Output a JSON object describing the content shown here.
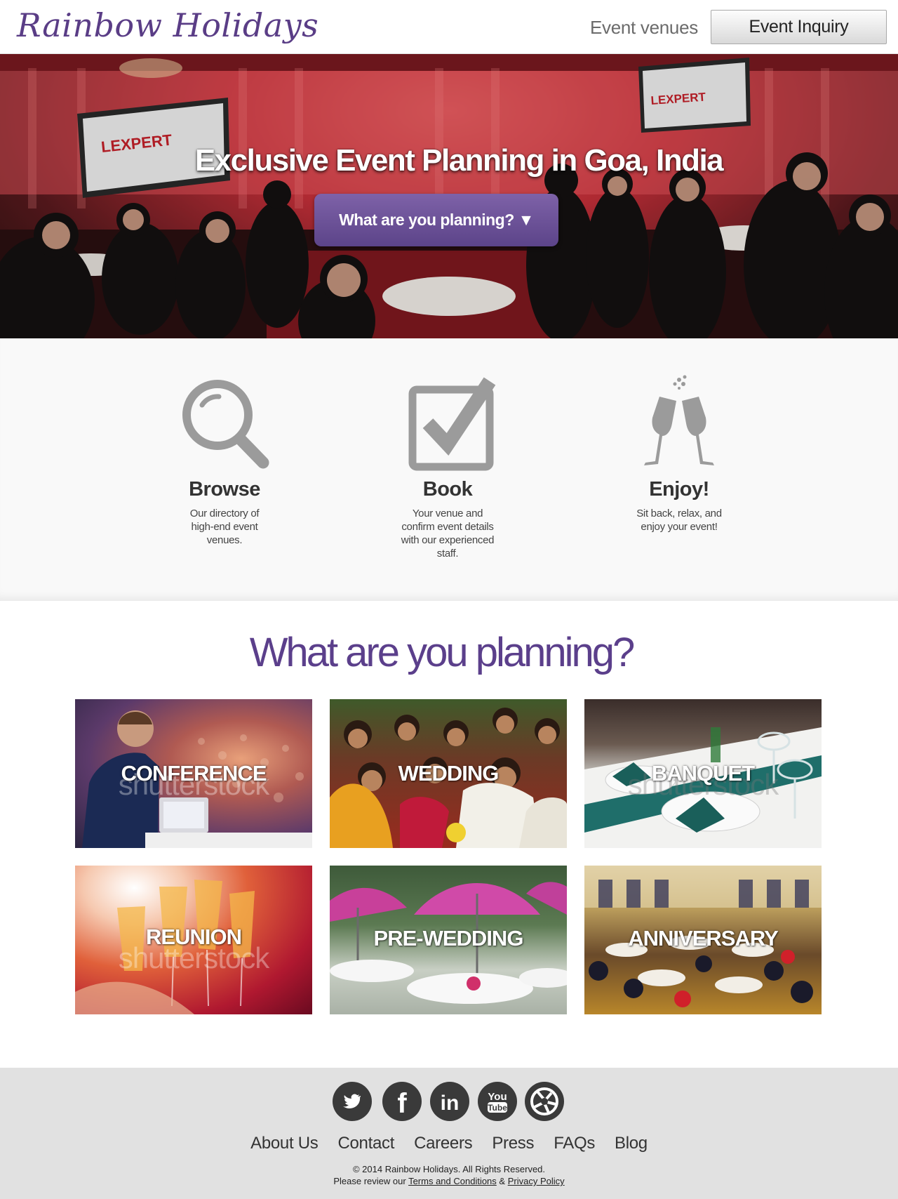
{
  "header": {
    "logo": "Rainbow Holidays",
    "nav_venues": "Event venues",
    "inquiry_button": "Event Inquiry"
  },
  "hero": {
    "title": "Exclusive Event Planning in Goa, India",
    "button_label": "What are you planning? ▼",
    "screen_text": "LEXPERT"
  },
  "steps": [
    {
      "icon": "magnifier-icon",
      "title": "Browse",
      "description": "Our directory of high-end event venues."
    },
    {
      "icon": "checkbox-icon",
      "title": "Book",
      "description": "Your venue and confirm event details with our experienced staff."
    },
    {
      "icon": "champagne-icon",
      "title": "Enjoy!",
      "description": "Sit back, relax, and enjoy your event!"
    }
  ],
  "planning": {
    "title": "What are you planning?",
    "watermark": "shutterstock",
    "tiles": [
      {
        "label": "CONFERENCE"
      },
      {
        "label": "WEDDING"
      },
      {
        "label": "BANQUET"
      },
      {
        "label": "REUNION"
      },
      {
        "label": "PRE-WEDDING"
      },
      {
        "label": "ANNIVERSARY"
      }
    ]
  },
  "footer": {
    "social": [
      "twitter-icon",
      "facebook-icon",
      "linkedin-icon",
      "youtube-icon",
      "picasa-icon"
    ],
    "youtube_text_1": "You",
    "youtube_text_2": "Tube",
    "linkedin_text": "in",
    "facebook_text": "f",
    "links": [
      "About Us",
      "Contact",
      "Careers",
      "Press",
      "FAQs",
      "Blog"
    ],
    "copyright": "© 2014 Rainbow Holidays. All Rights Reserved.",
    "review_prefix": "Please review our",
    "terms": "Terms and Conditions",
    "amp": "&",
    "privacy": "Privacy Policy"
  },
  "colors": {
    "brand_purple": "#5a3d86",
    "button_purple": "#6a4f97",
    "footer_gray": "#e1e1e1",
    "icon_gray": "#9b9b9b"
  }
}
